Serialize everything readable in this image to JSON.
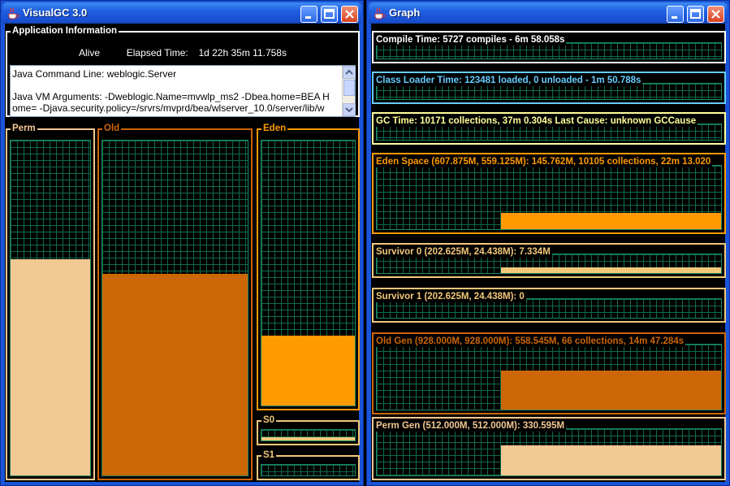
{
  "colors": {
    "perm": "#f2c894",
    "old": "#cc6606",
    "eden": "#ff9a00",
    "survivor": "#f2c87a",
    "compile": "#ffffff",
    "classloader": "#66ccff",
    "gctime": "#ffff99"
  },
  "vgc_window": {
    "title": "VisualGC 3.0",
    "app_info": {
      "legend": "Application Information",
      "status": "Alive",
      "elapsed_label": "Elapsed Time:",
      "elapsed_value": "1d 22h 35m 11.758s",
      "command_line": "Java Command Line: weblogic.Server",
      "vm_args_line1": "Java VM Arguments: -Dweblogic.Name=mvwlp_ms2 -Dbea.home=BEA H",
      "vm_args_line2": "ome= -Djava.security.policy=/srvrs/mvprd/bea/wlserver_10.0/server/lib/w"
    },
    "spaces": {
      "perm": {
        "label": "Perm",
        "fill": 0.645
      },
      "old": {
        "label": "Old",
        "fill": 0.602
      },
      "eden": {
        "label": "Eden",
        "fill": 0.263
      },
      "s0": {
        "label": "S0",
        "fill": 0.3
      },
      "s1": {
        "label": "S1",
        "fill": 0
      }
    }
  },
  "graph_window": {
    "title": "Graph",
    "graphs": {
      "compile": {
        "label": "Compile Time: 5727 compiles - 6m 58.058s"
      },
      "classloader": {
        "label": "Class Loader Time: 123481 loaded, 0 unloaded - 1m 50.788s"
      },
      "gctime": {
        "label": "GC Time: 10171 collections, 37m 0.304s  Last Cause: unknown GCCause"
      },
      "eden": {
        "label": "Eden Space (607.875M, 559.125M): 145.762M, 10105 collections, 22m 13.020",
        "level": 0.26
      },
      "s0": {
        "label": "Survivor 0 (202.625M, 24.438M): 7.334M",
        "level": 0.3
      },
      "s1": {
        "label": "Survivor 1 (202.625M, 24.438M): 0",
        "level": 0
      },
      "oldgen": {
        "label": "Old Gen (928.000M, 928.000M): 558.545M, 66 collections, 14m 47.284s",
        "level": 0.6
      },
      "permgen": {
        "label": "Perm Gen (512.000M, 512.000M): 330.595M",
        "level": 0.645
      }
    }
  }
}
